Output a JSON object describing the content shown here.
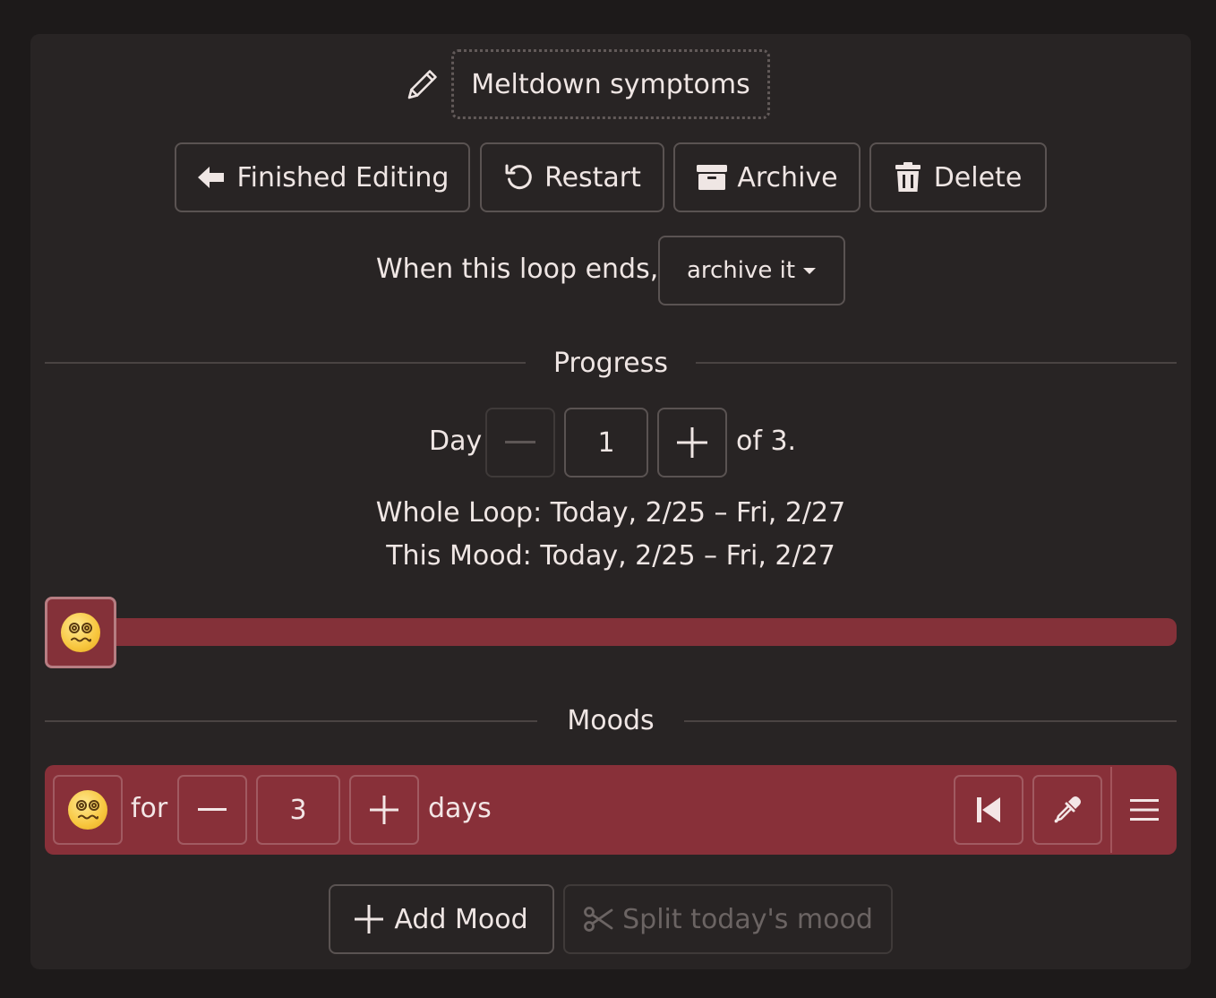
{
  "loop": {
    "title": "Meltdown symptoms"
  },
  "toolbar": {
    "finished_label": "Finished Editing",
    "restart_label": "Restart",
    "archive_label": "Archive",
    "delete_label": "Delete"
  },
  "loop_end": {
    "prefix": "When this loop ends,",
    "selected": "archive it"
  },
  "progress": {
    "heading": "Progress",
    "day_label": "Day",
    "day_value": "1",
    "of_text": "of 3.",
    "whole_loop": "Whole Loop: Today, 2/25 – Fri, 2/27",
    "this_mood": "This Mood: Today, 2/25 – Fri, 2/27",
    "track_color": "#843139"
  },
  "moods": {
    "heading": "Moods",
    "rows": [
      {
        "emoji": "face-with-spiral-eyes",
        "for_label": "for",
        "days_value": "3",
        "days_label": "days",
        "color": "#883039"
      }
    ]
  },
  "actions": {
    "add_mood_label": "Add Mood",
    "split_label": "Split today's mood"
  },
  "colors": {
    "background": "#1d1a1a",
    "card": "#282424",
    "mood_accent": "#883039"
  }
}
